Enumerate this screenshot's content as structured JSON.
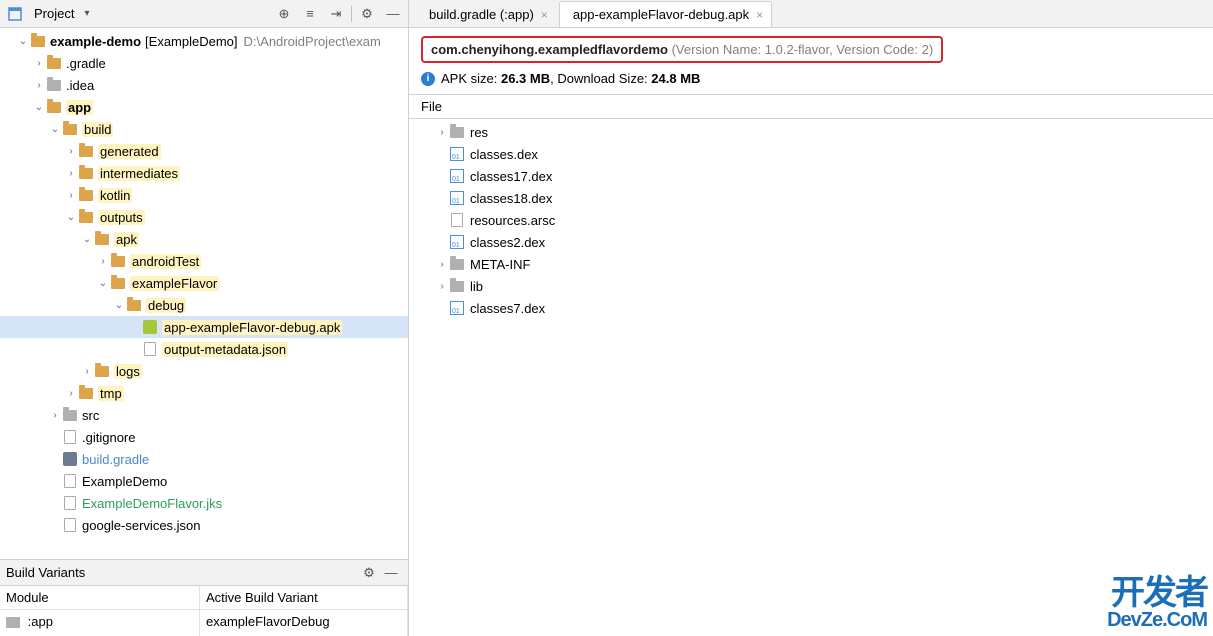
{
  "projectPane": {
    "title": "Project",
    "rootName": "example-demo",
    "rootBracket": "[ExampleDemo]",
    "rootPath": "D:\\AndroidProject\\exam",
    "tree": [
      {
        "depth": 1,
        "chev": "v",
        "icon": "folder",
        "label": "example-demo",
        "bold": true,
        "extraBracket": "[ExampleDemo]",
        "extraPath": "D:\\AndroidProject\\exam"
      },
      {
        "depth": 2,
        "chev": ">",
        "icon": "folder",
        "label": ".gradle"
      },
      {
        "depth": 2,
        "chev": ">",
        "icon": "folder-gray",
        "label": ".idea"
      },
      {
        "depth": 2,
        "chev": "v",
        "icon": "folder",
        "label": "app",
        "bold": true,
        "hl": true
      },
      {
        "depth": 3,
        "chev": "v",
        "icon": "folder",
        "label": "build",
        "hl": true
      },
      {
        "depth": 4,
        "chev": ">",
        "icon": "folder",
        "label": "generated",
        "hl": true
      },
      {
        "depth": 4,
        "chev": ">",
        "icon": "folder",
        "label": "intermediates",
        "hl": true
      },
      {
        "depth": 4,
        "chev": ">",
        "icon": "folder",
        "label": "kotlin",
        "hl": true
      },
      {
        "depth": 4,
        "chev": "v",
        "icon": "folder",
        "label": "outputs",
        "hl": true
      },
      {
        "depth": 5,
        "chev": "v",
        "icon": "folder",
        "label": "apk",
        "hl": true
      },
      {
        "depth": 6,
        "chev": ">",
        "icon": "folder",
        "label": "androidTest",
        "hl": true
      },
      {
        "depth": 6,
        "chev": "v",
        "icon": "folder",
        "label": "exampleFlavor",
        "hl": true
      },
      {
        "depth": 7,
        "chev": "v",
        "icon": "folder",
        "label": "debug",
        "hl": true
      },
      {
        "depth": 8,
        "chev": "",
        "icon": "apk",
        "label": "app-exampleFlavor-debug.apk",
        "hl": true,
        "selected": true
      },
      {
        "depth": 8,
        "chev": "",
        "icon": "file",
        "label": "output-metadata.json",
        "hl": true
      },
      {
        "depth": 5,
        "chev": ">",
        "icon": "folder",
        "label": "logs",
        "hl": true
      },
      {
        "depth": 4,
        "chev": ">",
        "icon": "folder",
        "label": "tmp",
        "hl": true
      },
      {
        "depth": 3,
        "chev": ">",
        "icon": "folder-gray",
        "label": "src"
      },
      {
        "depth": 3,
        "chev": "",
        "icon": "file",
        "label": ".gitignore"
      },
      {
        "depth": 3,
        "chev": "",
        "icon": "gradle",
        "label": "build.gradle",
        "colorLabel": "#4a88c7"
      },
      {
        "depth": 3,
        "chev": "",
        "icon": "file",
        "label": "ExampleDemo"
      },
      {
        "depth": 3,
        "chev": "",
        "icon": "file",
        "label": "ExampleDemoFlavor.jks",
        "colorLabel": "#2e9e5b"
      },
      {
        "depth": 3,
        "chev": "",
        "icon": "file",
        "label": "google-services.json"
      }
    ]
  },
  "buildVariants": {
    "title": "Build Variants",
    "colModule": "Module",
    "colVariant": "Active Build Variant",
    "rowModule": ":app",
    "rowVariant": "exampleFlavorDebug"
  },
  "tabs": [
    {
      "icon": "gradle",
      "label": "build.gradle (:app)",
      "active": false
    },
    {
      "icon": "apk",
      "label": "app-exampleFlavor-debug.apk",
      "active": true
    }
  ],
  "apkDetail": {
    "packageName": "com.chenyihong.exampledflavordemo",
    "versionMeta": "(Version Name: 1.0.2-flavor, Version Code: 2)",
    "sizePrefix": "APK size: ",
    "apkSize": "26.3 MB",
    "sizeMid": ", Download Size: ",
    "dlSize": "24.8 MB",
    "fileHeader": "File",
    "files": [
      {
        "chev": ">",
        "icon": "folder-gray",
        "label": "res"
      },
      {
        "chev": "",
        "icon": "dex",
        "label": "classes.dex"
      },
      {
        "chev": "",
        "icon": "dex",
        "label": "classes17.dex"
      },
      {
        "chev": "",
        "icon": "dex",
        "label": "classes18.dex"
      },
      {
        "chev": "",
        "icon": "file",
        "label": "resources.arsc"
      },
      {
        "chev": "",
        "icon": "dex",
        "label": "classes2.dex"
      },
      {
        "chev": ">",
        "icon": "folder-gray",
        "label": "META-INF"
      },
      {
        "chev": ">",
        "icon": "folder-gray",
        "label": "lib"
      },
      {
        "chev": "",
        "icon": "dex",
        "label": "classes7.dex"
      }
    ]
  },
  "watermark": {
    "cn": "开发者",
    "en": "DevZe.CoM"
  }
}
